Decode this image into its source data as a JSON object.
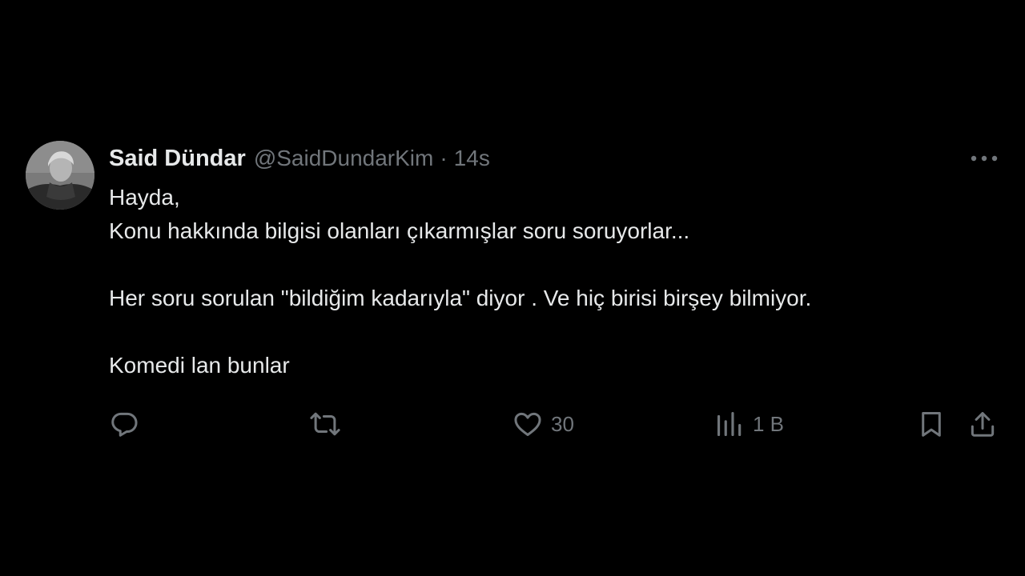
{
  "tweet": {
    "author_name": "Said Dündar",
    "handle": "@SaidDundarKim",
    "separator": "·",
    "time": "14s",
    "lines": [
      "Hayda,",
      "Konu hakkında bilgisi olanları çıkarmışlar soru soruyorlar...",
      "Her soru sorulan \"bildiğim kadarıyla\" diyor . Ve hiç birisi birşey bilmiyor.",
      "Komedi lan bunlar"
    ]
  },
  "actions": {
    "reply": {
      "icon": "reply-icon",
      "count": ""
    },
    "retweet": {
      "icon": "retweet-icon",
      "count": ""
    },
    "like": {
      "icon": "heart-icon",
      "count": "30"
    },
    "views": {
      "icon": "views-icon",
      "count": "1 B"
    },
    "bookmark": {
      "icon": "bookmark-icon"
    },
    "share": {
      "icon": "share-icon"
    }
  },
  "colors": {
    "background": "#000000",
    "text": "#e7e9ea",
    "secondary": "#71767b"
  }
}
